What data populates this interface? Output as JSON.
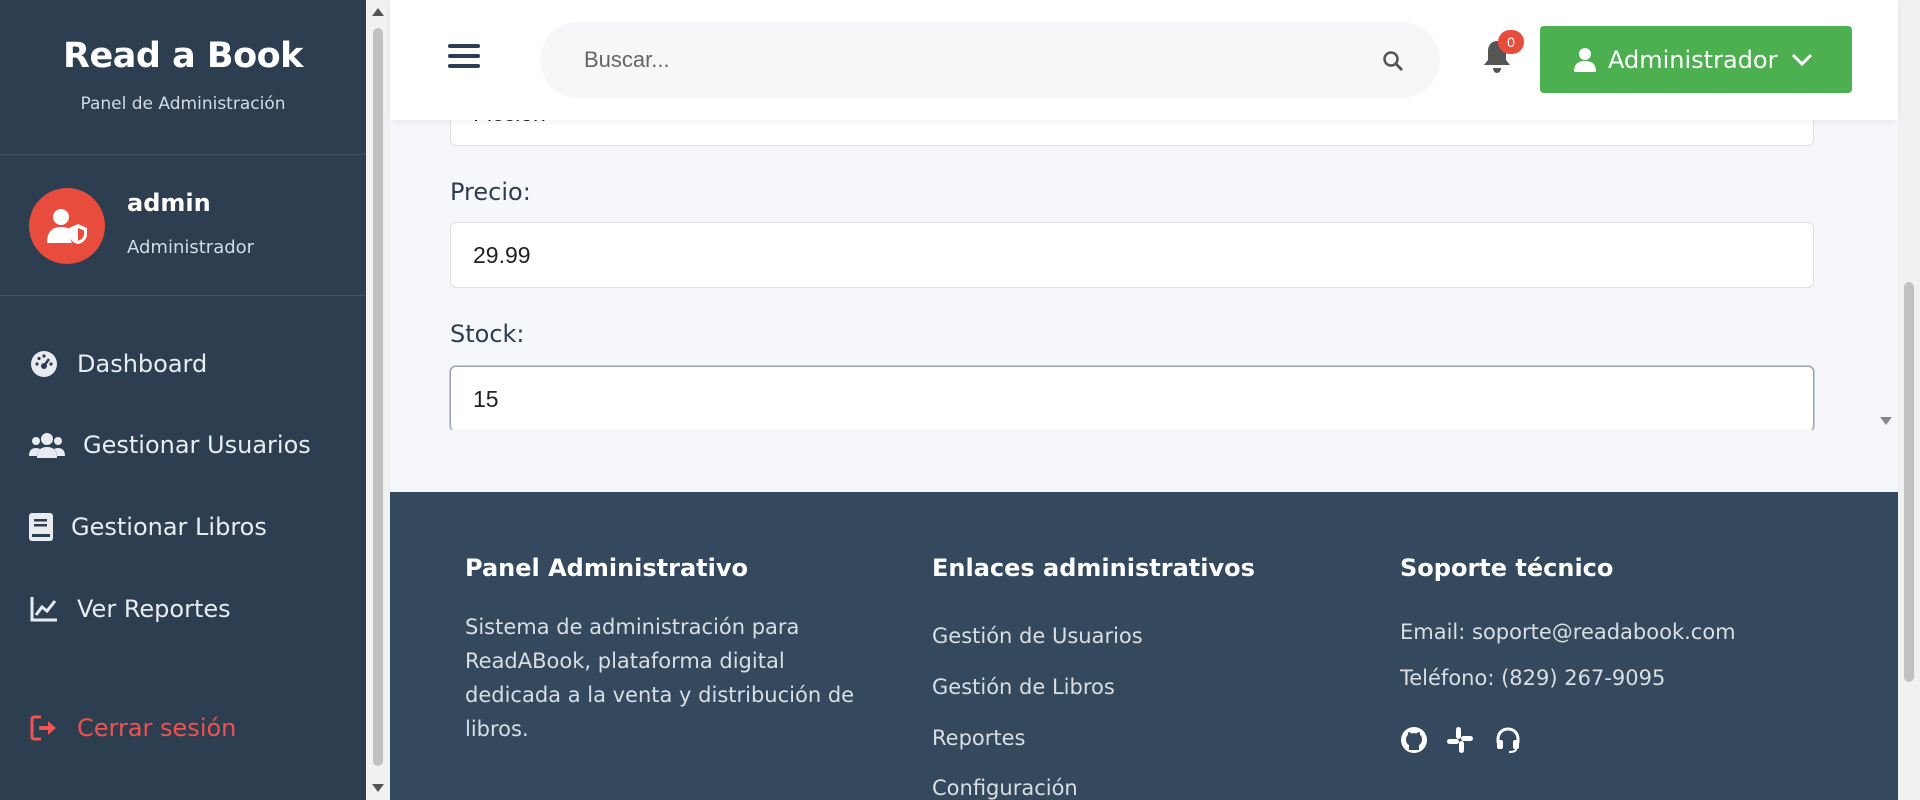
{
  "sidebar": {
    "brand_title": "Read a Book",
    "brand_subtitle": "Panel de Administración",
    "user": {
      "name": "admin",
      "role": "Administrador"
    },
    "nav": [
      {
        "label": "Dashboard",
        "icon": "dashboard-icon"
      },
      {
        "label": "Gestionar Usuarios",
        "icon": "users-icon"
      },
      {
        "label": "Gestionar Libros",
        "icon": "book-icon"
      },
      {
        "label": "Ver Reportes",
        "icon": "chart-line-icon"
      }
    ],
    "logout_label": "Cerrar sesión"
  },
  "header": {
    "search_placeholder": "Buscar...",
    "notification_count": "0",
    "admin_label": "Administrador"
  },
  "form": {
    "partial_field_value": "Ficción",
    "price_label": "Precio:",
    "price_value": "29.99",
    "stock_label": "Stock:",
    "stock_value": "15"
  },
  "footer": {
    "col1": {
      "title": "Panel Administrativo",
      "text": "Sistema de administración para ReadABook, plataforma digital dedicada a la venta y distribución de libros."
    },
    "col2": {
      "title": "Enlaces administrativos",
      "links": [
        "Gestión de Usuarios",
        "Gestión de Libros",
        "Reportes",
        "Configuración"
      ]
    },
    "col3": {
      "title": "Soporte técnico",
      "email": "Email: soporte@readabook.com",
      "phone": "Teléfono: (829) 267-9095"
    }
  },
  "colors": {
    "sidebar_bg": "#2c3e50",
    "footer_bg": "#34495e",
    "accent_green": "#4caf50",
    "danger_red": "#e74c3c"
  }
}
